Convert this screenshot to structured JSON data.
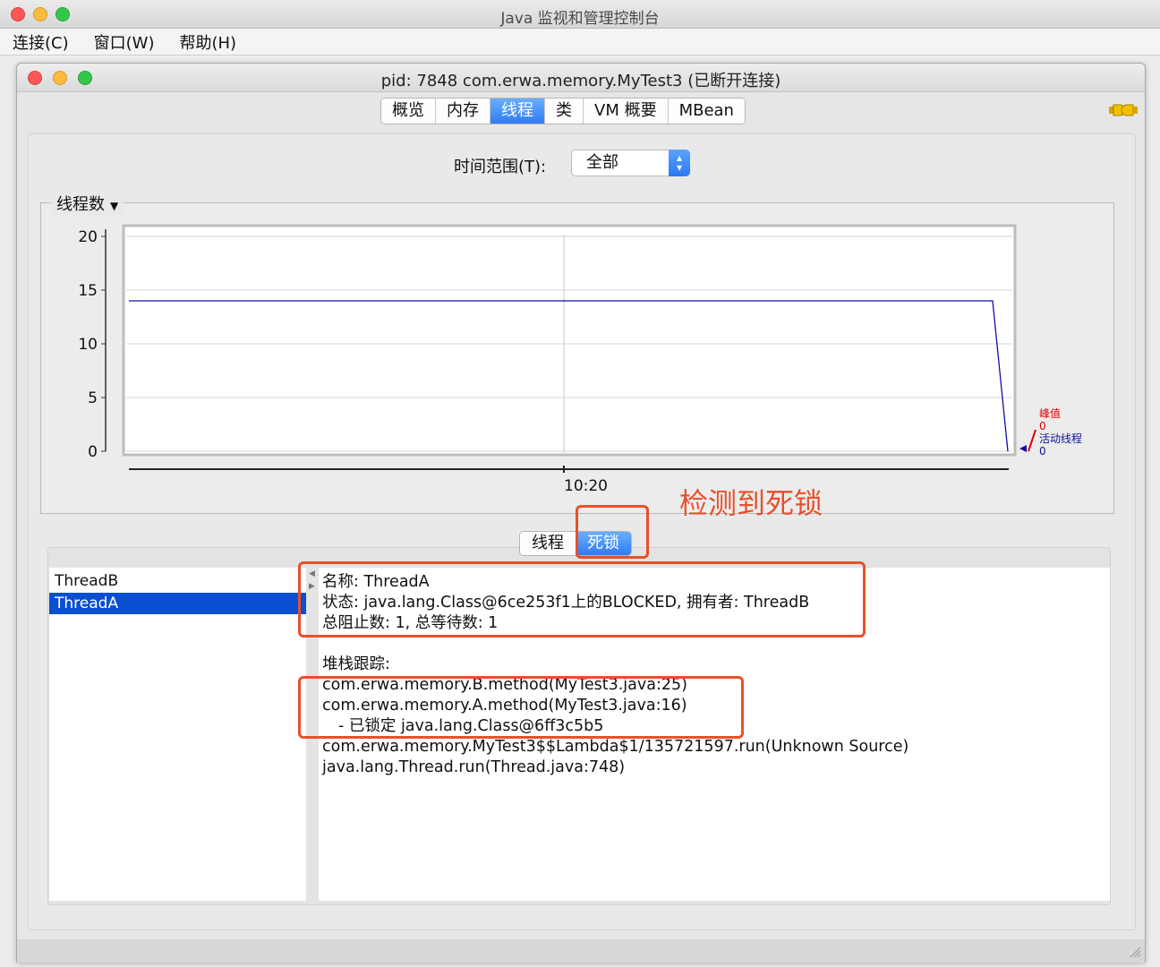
{
  "window": {
    "title": "Java 监视和管理控制台"
  },
  "menu": {
    "items": [
      "连接(C)",
      "窗口(W)",
      "帮助(H)"
    ]
  },
  "inner_window": {
    "title": "pid: 7848 com.erwa.memory.MyTest3 (已断开连接)"
  },
  "tabs": [
    "概览",
    "内存",
    "线程",
    "类",
    "VM 概要",
    "MBean"
  ],
  "active_tab": "线程",
  "time_range": {
    "label": "时间范围(T):",
    "value": "全部"
  },
  "chart_group": {
    "title": "线程数"
  },
  "chart_data": {
    "type": "line",
    "ylim": [
      0,
      20
    ],
    "yticks": [
      "20",
      "15",
      "10",
      "5",
      "0"
    ],
    "xticks": [
      "10:20"
    ],
    "series": [
      {
        "name": "峰值",
        "color": "#e00000",
        "current": "0"
      },
      {
        "name": "活动线程",
        "color": "#1010a0",
        "current": "0",
        "values": [
          14,
          14,
          0
        ]
      }
    ]
  },
  "annotation": {
    "text": "检测到死锁",
    "color": "#e8502a"
  },
  "subtabs": [
    "线程",
    "死锁"
  ],
  "active_subtab": "死锁",
  "threads": [
    "ThreadB",
    "ThreadA"
  ],
  "selected_thread": "ThreadA",
  "detail": {
    "name_line": "名称: ThreadA",
    "state_line": "状态: java.lang.Class@6ce253f1上的BLOCKED, 拥有者: ThreadB",
    "counts_line": "总阻止数: 1, 总等待数: 1",
    "stack_title": "堆栈跟踪:",
    "stack": [
      "com.erwa.memory.B.method(MyTest3.java:25)",
      "com.erwa.memory.A.method(MyTest3.java:16)",
      "- 已锁定 java.lang.Class@6ff3c5b5",
      "com.erwa.memory.MyTest3$$Lambda$1/135721597.run(Unknown Source)",
      "java.lang.Thread.run(Thread.java:748)"
    ]
  }
}
